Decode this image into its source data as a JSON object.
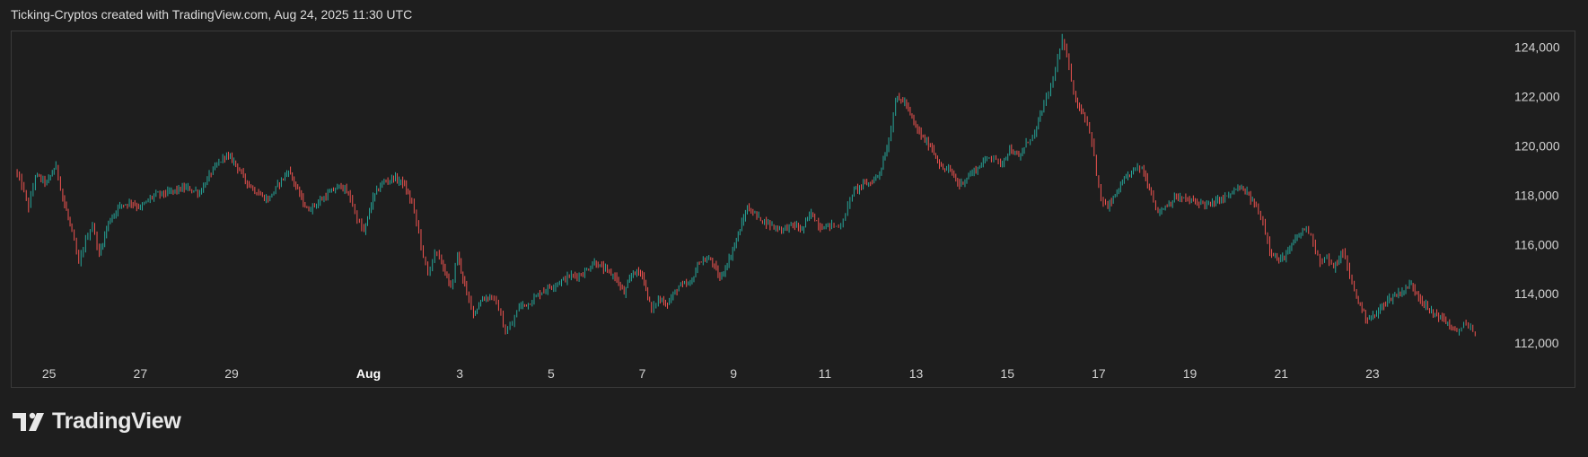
{
  "header": {
    "text": "Ticking-Cryptos created with TradingView.com, Aug 24, 2025 11:30 UTC"
  },
  "brand": {
    "name": "TradingView",
    "logo_icon": "tradingview-logo-icon"
  },
  "colors": {
    "background": "#1e1e1e",
    "up": "#26a69a",
    "down": "#ef5350",
    "axis_text": "#d1d1d1",
    "border": "#3a3a3a"
  },
  "chart_data": {
    "type": "line",
    "title": "",
    "xlabel": "",
    "ylabel": "",
    "grid": false,
    "x_ticks": [
      {
        "day": 25,
        "label": "25",
        "month": false
      },
      {
        "day": 27,
        "label": "27",
        "month": false
      },
      {
        "day": 29,
        "label": "29",
        "month": false
      },
      {
        "day": 32,
        "label": "Aug",
        "month": true
      },
      {
        "day": 34,
        "label": "3",
        "month": false
      },
      {
        "day": 36,
        "label": "5",
        "month": false
      },
      {
        "day": 38,
        "label": "7",
        "month": false
      },
      {
        "day": 40,
        "label": "9",
        "month": false
      },
      {
        "day": 42,
        "label": "11",
        "month": false
      },
      {
        "day": 44,
        "label": "13",
        "month": false
      },
      {
        "day": 46,
        "label": "15",
        "month": false
      },
      {
        "day": 48,
        "label": "17",
        "month": false
      },
      {
        "day": 50,
        "label": "19",
        "month": false
      },
      {
        "day": 52,
        "label": "21",
        "month": false
      },
      {
        "day": 54,
        "label": "23",
        "month": false
      }
    ],
    "y_ticks": [
      112000,
      114000,
      116000,
      118000,
      120000,
      122000,
      124000
    ],
    "y_tick_labels": [
      "112,000",
      "114,000",
      "116,000",
      "118,000",
      "120,000",
      "122,000",
      "124,000"
    ],
    "ylim": [
      111350,
      124600
    ],
    "xlim": [
      24.2,
      56.5
    ],
    "series": [
      {
        "values": [
          [
            24.25,
            119000
          ],
          [
            24.4,
            118400
          ],
          [
            24.55,
            117500
          ],
          [
            24.7,
            118800
          ],
          [
            24.95,
            118500
          ],
          [
            25.15,
            119200
          ],
          [
            25.3,
            117900
          ],
          [
            25.5,
            116500
          ],
          [
            25.65,
            115200
          ],
          [
            25.8,
            116200
          ],
          [
            25.95,
            116800
          ],
          [
            26.1,
            115600
          ],
          [
            26.3,
            116900
          ],
          [
            26.55,
            117600
          ],
          [
            26.8,
            117700
          ],
          [
            27.0,
            117500
          ],
          [
            27.3,
            118000
          ],
          [
            27.6,
            118100
          ],
          [
            27.8,
            118200
          ],
          [
            28.0,
            118300
          ],
          [
            28.3,
            118100
          ],
          [
            28.55,
            118900
          ],
          [
            28.85,
            119600
          ],
          [
            29.05,
            119400
          ],
          [
            29.3,
            118600
          ],
          [
            29.55,
            118100
          ],
          [
            29.8,
            117800
          ],
          [
            30.05,
            118500
          ],
          [
            30.25,
            119000
          ],
          [
            30.45,
            118200
          ],
          [
            30.65,
            117400
          ],
          [
            30.9,
            117700
          ],
          [
            31.15,
            118100
          ],
          [
            31.4,
            118400
          ],
          [
            31.6,
            117900
          ],
          [
            31.75,
            117000
          ],
          [
            31.9,
            116500
          ],
          [
            32.1,
            117900
          ],
          [
            32.3,
            118500
          ],
          [
            32.55,
            118700
          ],
          [
            32.75,
            118500
          ],
          [
            32.95,
            117700
          ],
          [
            33.1,
            116500
          ],
          [
            33.2,
            115500
          ],
          [
            33.3,
            114800
          ],
          [
            33.45,
            115700
          ],
          [
            33.6,
            115300
          ],
          [
            33.8,
            114200
          ],
          [
            33.95,
            115600
          ],
          [
            34.15,
            114000
          ],
          [
            34.3,
            113200
          ],
          [
            34.5,
            113800
          ],
          [
            34.7,
            113900
          ],
          [
            34.85,
            113400
          ],
          [
            35.0,
            112400
          ],
          [
            35.15,
            112800
          ],
          [
            35.3,
            113500
          ],
          [
            35.5,
            113600
          ],
          [
            35.8,
            114100
          ],
          [
            36.1,
            114400
          ],
          [
            36.4,
            114700
          ],
          [
            36.7,
            114800
          ],
          [
            36.95,
            115300
          ],
          [
            37.15,
            115000
          ],
          [
            37.4,
            114700
          ],
          [
            37.6,
            114000
          ],
          [
            37.8,
            114900
          ],
          [
            38.0,
            114800
          ],
          [
            38.2,
            113300
          ],
          [
            38.35,
            113800
          ],
          [
            38.55,
            113600
          ],
          [
            38.8,
            114300
          ],
          [
            39.05,
            114400
          ],
          [
            39.25,
            115300
          ],
          [
            39.5,
            115400
          ],
          [
            39.7,
            114600
          ],
          [
            39.9,
            115400
          ],
          [
            40.1,
            116400
          ],
          [
            40.3,
            117500
          ],
          [
            40.55,
            117100
          ],
          [
            40.8,
            116800
          ],
          [
            41.05,
            116600
          ],
          [
            41.3,
            116800
          ],
          [
            41.5,
            116600
          ],
          [
            41.7,
            117300
          ],
          [
            41.9,
            116700
          ],
          [
            42.15,
            116800
          ],
          [
            42.3,
            116700
          ],
          [
            42.45,
            117200
          ],
          [
            42.6,
            118100
          ],
          [
            42.8,
            118400
          ],
          [
            43.0,
            118500
          ],
          [
            43.2,
            118900
          ],
          [
            43.4,
            120200
          ],
          [
            43.55,
            121900
          ],
          [
            43.75,
            121800
          ],
          [
            43.95,
            120900
          ],
          [
            44.15,
            120300
          ],
          [
            44.35,
            119900
          ],
          [
            44.55,
            119100
          ],
          [
            44.75,
            119000
          ],
          [
            44.95,
            118400
          ],
          [
            45.15,
            118800
          ],
          [
            45.35,
            119100
          ],
          [
            45.55,
            119500
          ],
          [
            45.7,
            119600
          ],
          [
            45.85,
            119200
          ],
          [
            46.05,
            119900
          ],
          [
            46.25,
            119500
          ],
          [
            46.45,
            120200
          ],
          [
            46.6,
            120500
          ],
          [
            46.8,
            121700
          ],
          [
            46.95,
            122400
          ],
          [
            47.1,
            123500
          ],
          [
            47.2,
            124300
          ],
          [
            47.35,
            123200
          ],
          [
            47.5,
            121800
          ],
          [
            47.7,
            121200
          ],
          [
            47.85,
            120200
          ],
          [
            47.95,
            118800
          ],
          [
            48.05,
            117800
          ],
          [
            48.2,
            117500
          ],
          [
            48.4,
            118100
          ],
          [
            48.6,
            118700
          ],
          [
            48.8,
            119100
          ],
          [
            48.95,
            119100
          ],
          [
            49.15,
            118100
          ],
          [
            49.3,
            117300
          ],
          [
            49.5,
            117600
          ],
          [
            49.7,
            117900
          ],
          [
            49.95,
            117800
          ],
          [
            50.2,
            117700
          ],
          [
            50.45,
            117600
          ],
          [
            50.65,
            117800
          ],
          [
            50.85,
            118000
          ],
          [
            51.05,
            118300
          ],
          [
            51.25,
            118100
          ],
          [
            51.45,
            117500
          ],
          [
            51.6,
            116900
          ],
          [
            51.75,
            115800
          ],
          [
            51.95,
            115300
          ],
          [
            52.15,
            115700
          ],
          [
            52.35,
            116300
          ],
          [
            52.55,
            116700
          ],
          [
            52.7,
            116100
          ],
          [
            52.85,
            115300
          ],
          [
            53.0,
            115500
          ],
          [
            53.15,
            115000
          ],
          [
            53.35,
            115700
          ],
          [
            53.5,
            114700
          ],
          [
            53.65,
            113900
          ],
          [
            53.85,
            113000
          ],
          [
            54.05,
            113100
          ],
          [
            54.25,
            113600
          ],
          [
            54.45,
            113900
          ],
          [
            54.65,
            114100
          ],
          [
            54.85,
            114400
          ],
          [
            55.05,
            113800
          ],
          [
            55.25,
            113300
          ],
          [
            55.45,
            113100
          ],
          [
            55.65,
            112800
          ],
          [
            55.85,
            112400
          ],
          [
            56.0,
            112800
          ],
          [
            56.15,
            112600
          ],
          [
            56.25,
            112200
          ]
        ]
      }
    ]
  }
}
